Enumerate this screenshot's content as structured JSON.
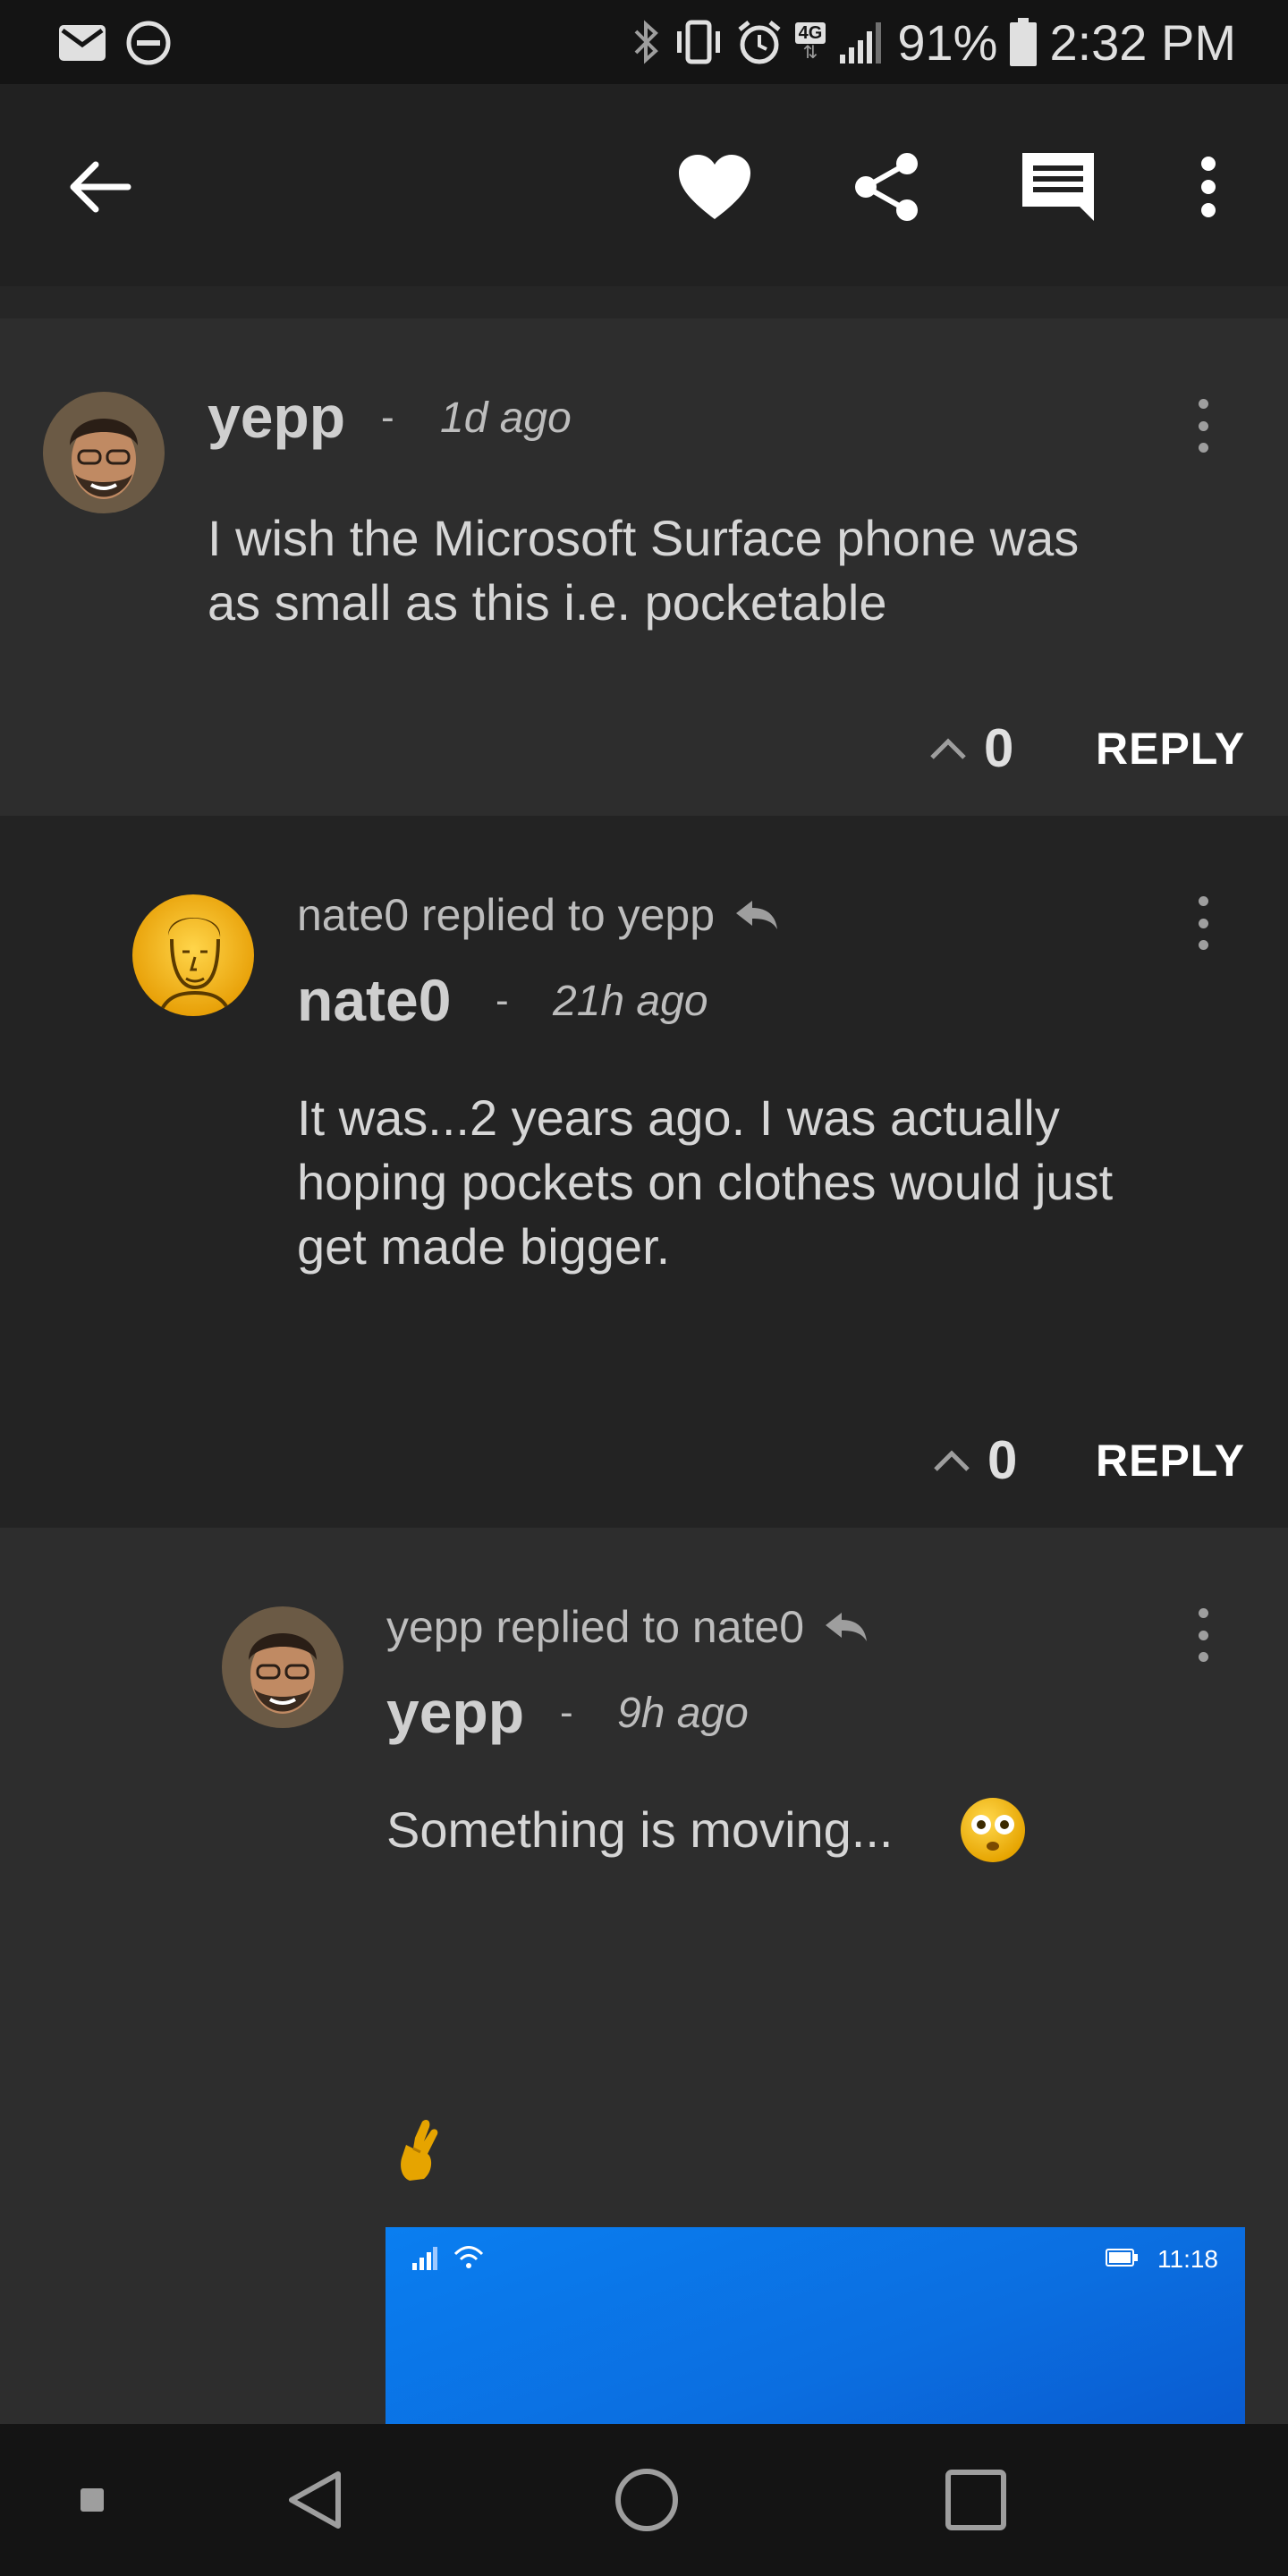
{
  "status_bar": {
    "battery_percent": "91%",
    "time": "2:32 PM",
    "network_badge": "4G",
    "icons": [
      "email-icon",
      "do-not-disturb-icon",
      "bluetooth-icon",
      "vibrate-icon",
      "alarm-icon",
      "lte-icon",
      "signal-icon",
      "battery-icon"
    ]
  },
  "app_bar": {
    "icons": [
      "back-arrow-icon",
      "heart-icon",
      "share-icon",
      "comment-icon",
      "overflow-menu-icon"
    ]
  },
  "comments": [
    {
      "author": "yepp",
      "separator": "-",
      "time": "1d ago",
      "text_lines": [
        "I wish the Microsoft Surface phone was",
        "as small as this i.e. pocketable"
      ],
      "votes": "0",
      "reply_label": "REPLY"
    },
    {
      "replied_to_text": "nate0 replied to yepp",
      "author": "nate0",
      "separator": "-",
      "time": "21h ago",
      "text_lines": [
        "It was...2 years ago.  I was actually",
        "hoping pockets on clothes would just",
        "get made bigger."
      ],
      "votes": "0",
      "reply_label": "REPLY"
    },
    {
      "replied_to_text": "yepp replied to nate0",
      "author": "yepp",
      "separator": "-",
      "time": "9h ago",
      "text": "Something is moving...",
      "emoji_1": "flushed-face",
      "emoji_2": "crossed-fingers",
      "embedded_screenshot_time": "11:18"
    }
  ],
  "colors": {
    "status_bar_bg": "#141414",
    "app_bar_bg": "#212121",
    "comment_bg_light": "#2d2d2d",
    "comment_bg_dark": "#232323",
    "preview_blue": "#0a7ef0"
  },
  "nav_bar": {
    "icons": [
      "recents-dot-icon",
      "back-triangle-icon",
      "home-circle-icon",
      "overview-square-icon"
    ]
  }
}
